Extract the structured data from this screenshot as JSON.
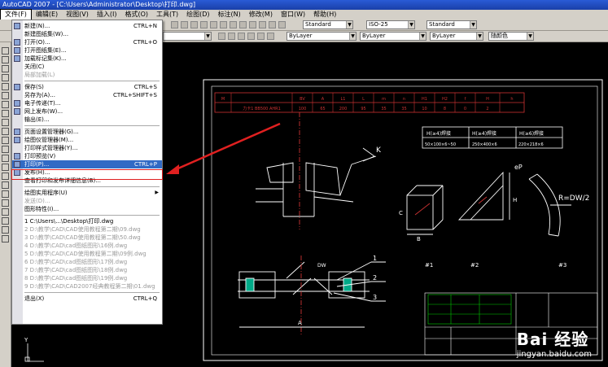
{
  "window": {
    "title": "AutoCAD 2007 - [C:\\Users\\Administrator\\Desktop\\打印.dwg]"
  },
  "menubar": [
    "文件(F)",
    "编辑(E)",
    "视图(V)",
    "插入(I)",
    "格式(O)",
    "工具(T)",
    "绘图(D)",
    "标注(N)",
    "修改(M)",
    "窗口(W)",
    "帮助(H)"
  ],
  "toolbar": {
    "style1": "Standard",
    "style2": "ISO-25",
    "style3": "Standard",
    "layer1": "ByLayer",
    "layer2": "ByLayer",
    "layer3": "ByLayer",
    "color": "随颜色"
  },
  "file_menu": {
    "items": [
      {
        "label": "新建(N)...",
        "shortcut": "CTRL+N",
        "icon": "new-file-icon",
        "disabled": false
      },
      {
        "label": "新建图纸集(W)...",
        "shortcut": "",
        "icon": "",
        "disabled": false
      },
      {
        "label": "打开(O)...",
        "shortcut": "CTRL+O",
        "icon": "open-folder-icon",
        "disabled": false
      },
      {
        "label": "打开图纸集(E)...",
        "shortcut": "",
        "icon": "sheetset-icon",
        "disabled": false
      },
      {
        "label": "加载标记集(K)...",
        "shortcut": "",
        "icon": "markup-icon",
        "disabled": false
      },
      {
        "label": "关闭(C)",
        "shortcut": "",
        "icon": "",
        "disabled": false
      },
      {
        "label": "局部加载(L)",
        "shortcut": "",
        "icon": "",
        "disabled": true
      },
      {
        "sep": true
      },
      {
        "label": "保存(S)",
        "shortcut": "CTRL+S",
        "icon": "save-icon",
        "disabled": false
      },
      {
        "label": "另存为(A)...",
        "shortcut": "CTRL+SHIFT+S",
        "icon": "",
        "disabled": false
      },
      {
        "label": "电子传递(T)...",
        "shortcut": "",
        "icon": "etransmit-icon",
        "disabled": false
      },
      {
        "label": "网上发布(W)...",
        "shortcut": "",
        "icon": "publish-web-icon",
        "disabled": false
      },
      {
        "label": "输出(E)...",
        "shortcut": "",
        "icon": "",
        "disabled": false
      },
      {
        "sep": true
      },
      {
        "label": "页面设置管理器(G)...",
        "shortcut": "",
        "icon": "page-setup-icon",
        "disabled": false
      },
      {
        "label": "绘图仪管理器(M)...",
        "shortcut": "",
        "icon": "plotter-icon",
        "disabled": false
      },
      {
        "label": "打印样式管理器(Y)...",
        "shortcut": "",
        "icon": "",
        "disabled": false
      },
      {
        "label": "打印预览(V)",
        "shortcut": "",
        "icon": "preview-icon",
        "disabled": false
      },
      {
        "label": "打印(P)...",
        "shortcut": "CTRL+P",
        "icon": "print-icon",
        "disabled": false,
        "selected": true
      },
      {
        "label": "发布(H)...",
        "shortcut": "",
        "icon": "publish-icon",
        "disabled": false
      },
      {
        "label": "查看打印和发布详细信息(B)...",
        "shortcut": "",
        "icon": "",
        "disabled": false
      },
      {
        "sep": true
      },
      {
        "label": "绘图实用程序(U)",
        "shortcut": "",
        "icon": "",
        "disabled": false,
        "submenu": true
      },
      {
        "label": "发送(D)...",
        "shortcut": "",
        "icon": "",
        "disabled": true
      },
      {
        "label": "图形特性(I)...",
        "shortcut": "",
        "icon": "",
        "disabled": false
      },
      {
        "sep": true
      },
      {
        "label": "1 C:\\Users\\...\\Desktop\\打印.dwg",
        "shortcut": "",
        "icon": "",
        "disabled": false
      },
      {
        "label": "2 D:\\教学\\CAD\\CAD使用教程第二期\\09.dwg",
        "shortcut": "",
        "icon": "",
        "disabled": true
      },
      {
        "label": "3 D:\\教学\\CAD\\CAD使用教程第二期\\50.dwg",
        "shortcut": "",
        "icon": "",
        "disabled": true
      },
      {
        "label": "4 D:\\教学\\CAD\\cad图纸图形\\16例.dwg",
        "shortcut": "",
        "icon": "",
        "disabled": true
      },
      {
        "label": "5 D:\\教学\\CAD\\CAD使用教程第二期\\09例.dwg",
        "shortcut": "",
        "icon": "",
        "disabled": true
      },
      {
        "label": "6 D:\\教学\\CAD\\cad图纸图形\\17例.dwg",
        "shortcut": "",
        "icon": "",
        "disabled": true
      },
      {
        "label": "7 D:\\教学\\CAD\\cad图纸图形\\18例.dwg",
        "shortcut": "",
        "icon": "",
        "disabled": true
      },
      {
        "label": "8 D:\\教学\\CAD\\cad图纸图形\\19例.dwg",
        "shortcut": "",
        "icon": "",
        "disabled": true
      },
      {
        "label": "9 D:\\教学\\CAD\\CAD2007经典教程第二期\\01.dwg",
        "shortcut": "",
        "icon": "",
        "disabled": true
      },
      {
        "sep": true
      },
      {
        "label": "退出(X)",
        "shortcut": "CTRL+Q",
        "icon": "",
        "disabled": false
      }
    ]
  },
  "drawing": {
    "table_header": [
      "M",
      "",
      "BV",
      "A",
      "L1",
      "L",
      "m",
      "n",
      "H1",
      "H2",
      "f",
      "H",
      "h"
    ],
    "table_row": [
      "",
      "力卡1 BB500 AHR1",
      "100",
      "65",
      "200",
      "95",
      "35",
      "35",
      "10",
      "8",
      "0",
      "2",
      ""
    ],
    "spec_headers": [
      "H(≥4)焊接",
      "H(≥4)焊接",
      "H(≥6)焊接"
    ],
    "spec_values": [
      "50×100×6~50",
      "250×400×6",
      "220×218×6"
    ],
    "labels": {
      "K": "K",
      "eP": "eP",
      "R": "R=DW/2",
      "p1": "#1",
      "p2": "#2",
      "p3": "#3",
      "n1": "1",
      "n2": "2",
      "n3": "3",
      "A": "A",
      "DW": "DW",
      "C": "C",
      "B": "B",
      "H": "H"
    }
  },
  "watermark": {
    "brand": "Bai 经验",
    "url": "jingyan.baidu.com"
  }
}
